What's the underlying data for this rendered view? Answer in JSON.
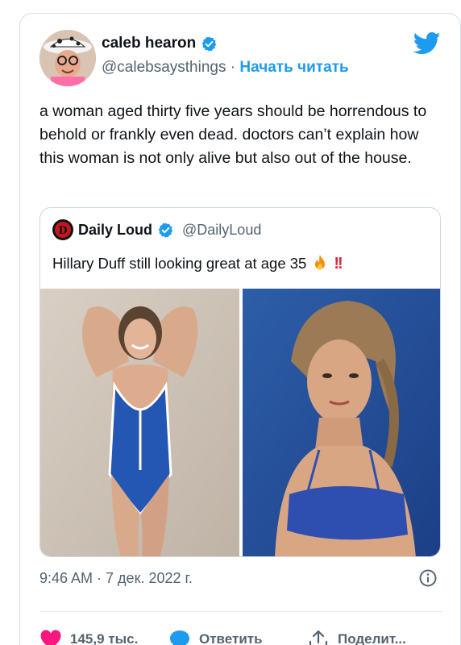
{
  "tweet": {
    "author_name": "caleb hearon",
    "author_handle": "@calebsaysthings",
    "separator": "·",
    "follow_label": "Начать читать",
    "text": "a woman aged thirty five years should be horrendous to behold or frankly even dead. doctors can’t explain how this woman is not only alive but also out of the house.",
    "timestamp": "9:46 AM · 7 дек. 2022 г."
  },
  "quote": {
    "author_name": "Daily Loud",
    "author_handle": "@DailyLoud",
    "text": "Hillary Duff still looking great at age 35",
    "emoji": "!!"
  },
  "actions": {
    "like_count": "145,9 тыс.",
    "reply_label": "Ответить",
    "share_label": "Поделит..."
  },
  "colors": {
    "accent": "#1d9bf0",
    "like": "#f91880",
    "secondary_text": "#536471"
  },
  "icons": [
    "verified-badge-icon",
    "twitter-bird-icon",
    "fire-icon",
    "info-icon",
    "heart-icon",
    "reply-bubble-icon",
    "share-icon"
  ]
}
